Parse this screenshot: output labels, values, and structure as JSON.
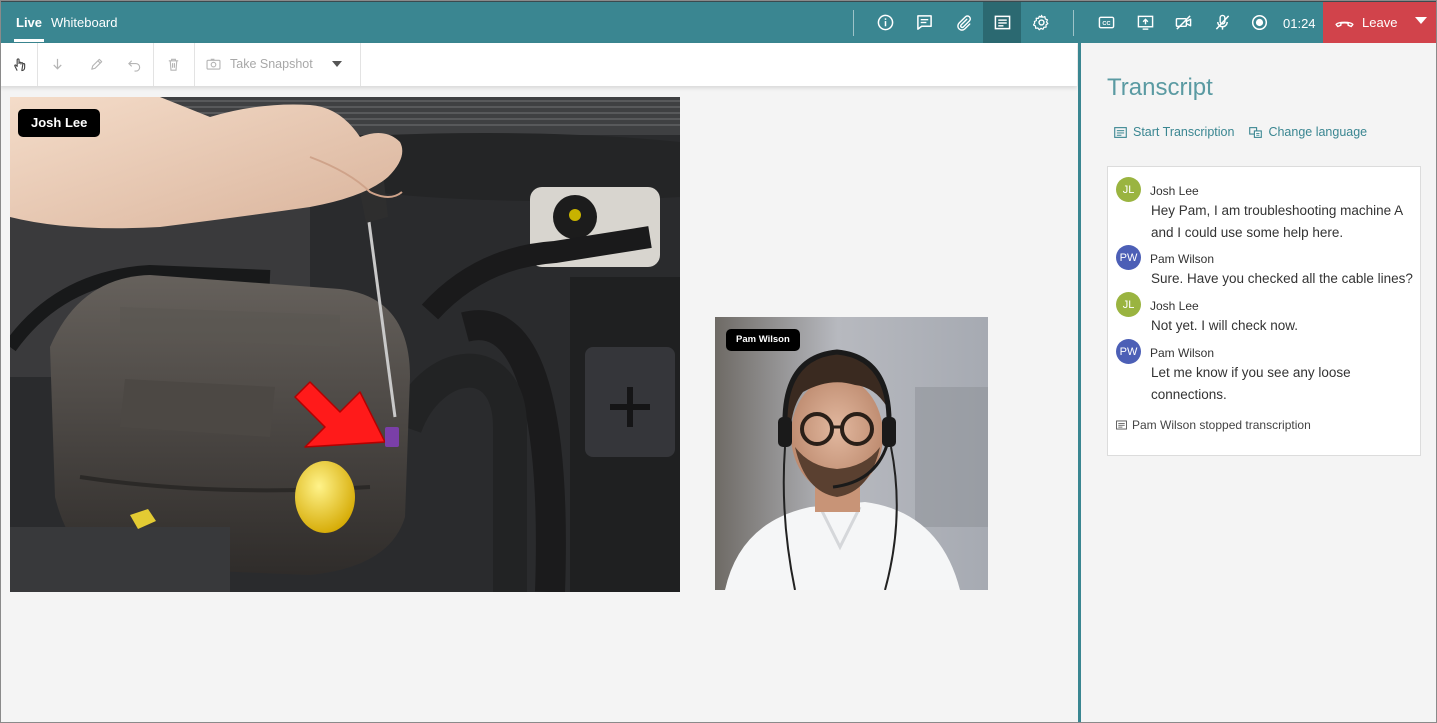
{
  "header": {
    "tabs": [
      {
        "label": "Live",
        "active": true
      },
      {
        "label": "Whiteboard",
        "active": false
      }
    ],
    "icons": [
      "info-icon",
      "chat-icon",
      "attachment-icon",
      "transcript-icon",
      "settings-icon",
      "captions-icon",
      "share-screen-icon",
      "camera-off-icon",
      "mic-off-icon",
      "record-icon"
    ],
    "timer": "01:24",
    "leave_label": "Leave",
    "colors": {
      "bar": "#3a8691",
      "leave": "#d1434b"
    }
  },
  "toolbar": {
    "tools": [
      "pointer-icon",
      "download-icon",
      "pen-icon",
      "undo-icon",
      "delete-icon"
    ],
    "snapshot_label": "Take Snapshot"
  },
  "videos": {
    "main": {
      "name": "Josh Lee"
    },
    "secondary": {
      "name": "Pam Wilson"
    }
  },
  "transcript": {
    "title": "Transcript",
    "start_label": "Start Transcription",
    "language_label": "Change language",
    "entries": [
      {
        "initials": "JL",
        "name": "Josh Lee",
        "color": "#9ab440",
        "text": "Hey Pam, I am troubleshooting machine A and I could use some help here."
      },
      {
        "initials": "PW",
        "name": "Pam Wilson",
        "color": "#4c5fb6",
        "text": "Sure. Have you checked all the cable lines?"
      },
      {
        "initials": "JL",
        "name": "Josh Lee",
        "color": "#9ab440",
        "text": "Not yet. I will check now."
      },
      {
        "initials": "PW",
        "name": "Pam Wilson",
        "color": "#4c5fb6",
        "text": "Let me know if you see any loose connections."
      }
    ],
    "status": "Pam Wilson stopped transcription"
  }
}
